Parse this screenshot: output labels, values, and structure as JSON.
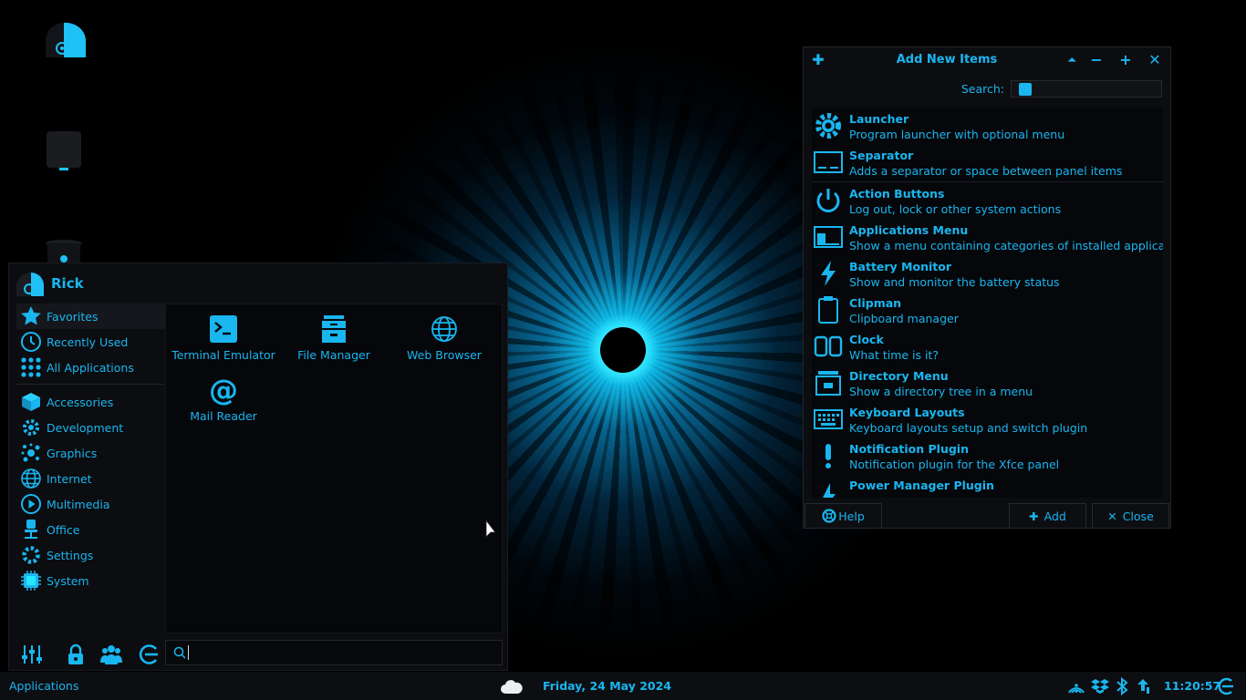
{
  "colors": {
    "accent": "#19b6f0",
    "bright": "#29e6ff",
    "background": "#000000",
    "panel": "#0d0e11"
  },
  "desktop": {
    "icons": [
      "home-drive-icon",
      "device-icon",
      "trash-icon"
    ]
  },
  "menu": {
    "username": "Rick",
    "categories": [
      {
        "label": "Favorites",
        "icon": "star-icon"
      },
      {
        "label": "Recently Used",
        "icon": "clock-icon"
      },
      {
        "label": "All Applications",
        "icon": "grid-icon"
      },
      {
        "label": "Accessories",
        "icon": "box-icon"
      },
      {
        "label": "Development",
        "icon": "gear-icon"
      },
      {
        "label": "Graphics",
        "icon": "paint-icon"
      },
      {
        "label": "Internet",
        "icon": "globe-icon"
      },
      {
        "label": "Multimedia",
        "icon": "play-icon"
      },
      {
        "label": "Office",
        "icon": "chair-icon"
      },
      {
        "label": "Settings",
        "icon": "gear-icon"
      },
      {
        "label": "System",
        "icon": "chip-icon"
      }
    ],
    "apps": [
      {
        "label": "Terminal Emulator",
        "icon": "terminal-icon"
      },
      {
        "label": "File Manager",
        "icon": "file-cabinet-icon"
      },
      {
        "label": "Web Browser",
        "icon": "globe-icon"
      },
      {
        "label": "Mail Reader",
        "icon": "at-sign-icon"
      }
    ],
    "footer_icons": [
      "settings-manager-icon",
      "lock-icon",
      "switch-user-icon",
      "logout-icon"
    ],
    "search_placeholder": ""
  },
  "dialog": {
    "title": "Add New Items",
    "search_label": "Search:",
    "items": [
      {
        "name": "Launcher",
        "desc": "Program launcher with optional menu",
        "icon": "gear-icon"
      },
      {
        "name": "Separator",
        "desc": "Adds a separator or space between panel items",
        "icon": "separator-icon"
      },
      {
        "name": "Action Buttons",
        "desc": "Log out, lock or other system actions",
        "icon": "power-icon"
      },
      {
        "name": "Applications Menu",
        "desc": "Show a menu containing categories of installed applications",
        "icon": "app-menu-icon"
      },
      {
        "name": "Battery Monitor",
        "desc": "Show and monitor the battery status",
        "icon": "lightning-icon"
      },
      {
        "name": "Clipman",
        "desc": "Clipboard manager",
        "icon": "clipboard-icon"
      },
      {
        "name": "Clock",
        "desc": "What time is it?",
        "icon": "digital-clock-icon"
      },
      {
        "name": "Directory Menu",
        "desc": "Show a directory tree in a menu",
        "icon": "file-cabinet-icon"
      },
      {
        "name": "Keyboard Layouts",
        "desc": "Keyboard layouts setup and switch plugin",
        "icon": "keyboard-icon"
      },
      {
        "name": "Notification Plugin",
        "desc": "Notification plugin for the Xfce panel",
        "icon": "exclamation-icon"
      },
      {
        "name": "Power Manager Plugin",
        "desc": "",
        "icon": "power-manager-icon"
      }
    ],
    "help_label": "Help",
    "add_label": "Add",
    "close_label": "Close"
  },
  "panel": {
    "applications_label": "Applications",
    "date": "Friday, 24 May 2024",
    "time": "11:20:57",
    "tray_icons": [
      "network-icon",
      "dropbox-icon",
      "bluetooth-icon",
      "share-icon",
      "logout-icon"
    ]
  }
}
